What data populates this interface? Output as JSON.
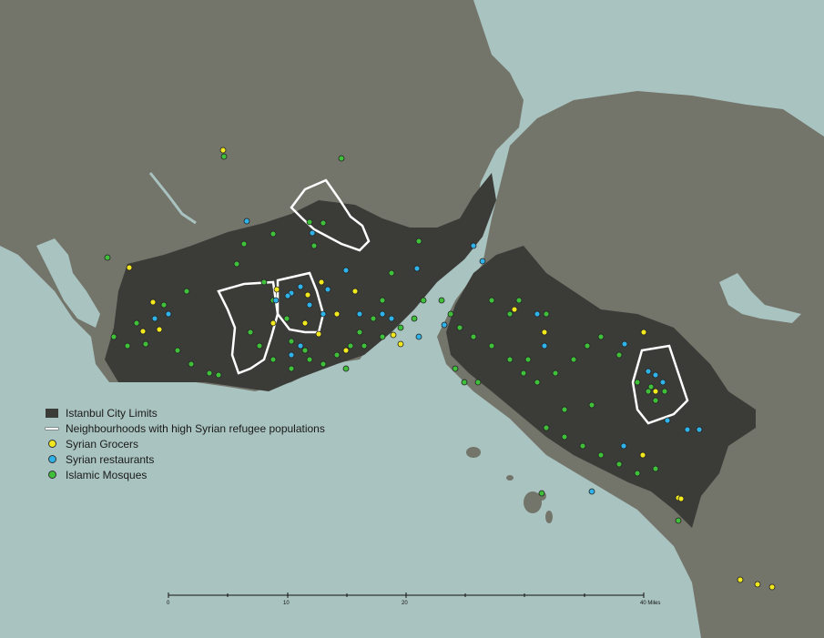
{
  "legend": {
    "items": [
      {
        "key": "city_limits",
        "label": "Istanbul City Limits",
        "color": "#3b3b38"
      },
      {
        "key": "neighbourhoods",
        "label": "Neighbourhoods with high Syrian refugee populations",
        "color": "#ffffff"
      },
      {
        "key": "grocers",
        "label": "Syrian Grocers",
        "color": "#f2e81e"
      },
      {
        "key": "restaurants",
        "label": "Syrian restaurants",
        "color": "#2fb2e8"
      },
      {
        "key": "mosques",
        "label": "Islamic Mosques",
        "color": "#3fbf3a"
      }
    ]
  },
  "scale_bar": {
    "ticks": [
      "0",
      "10",
      "20",
      "40 Miles"
    ]
  },
  "colors": {
    "water": "#a9c3c0",
    "land": "#73746a",
    "city": "#3b3b38",
    "outline": "#ffffff"
  }
}
